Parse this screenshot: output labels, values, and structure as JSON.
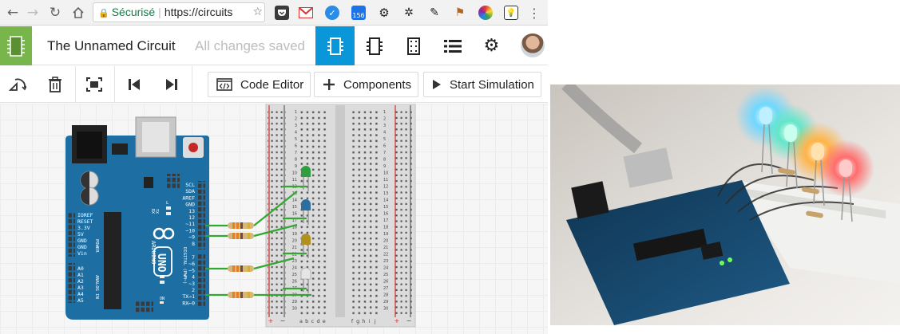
{
  "browser": {
    "secure_label": "Sécurisé",
    "url_text": "https://circuits",
    "extension_badge": "156"
  },
  "app": {
    "circuit_title": "The Unnamed Circuit",
    "save_status": "All changes saved"
  },
  "toolbar": {
    "code_editor_label": "Code Editor",
    "components_label": "Components",
    "start_simulation_label": "Start Simulation"
  },
  "arduino": {
    "brand": "ARDUINO",
    "model": "UNO",
    "digital_label": "DIGITAL (PWM~)",
    "power_label": "POWER",
    "analog_label": "ANALOG IN",
    "left_pins": [
      "IOREF",
      "RESET",
      "3.3V",
      "5V",
      "GND",
      "GND",
      "Vin"
    ],
    "analog_pins": [
      "A0",
      "A1",
      "A2",
      "A3",
      "A4",
      "A5"
    ],
    "top_right_pins": [
      "SCL",
      "SDA",
      "AREF",
      "GND",
      "13",
      "12",
      "~11",
      "~10",
      "~9",
      "8"
    ],
    "bottom_right_pins": [
      "7",
      "~6",
      "~5",
      "4",
      "~3",
      "2",
      "TX→1",
      "RX←0"
    ],
    "led_labels": [
      "TX",
      "RX"
    ],
    "l_label": "L",
    "on_label": "ON"
  },
  "breadboard": {
    "row_numbers": [
      "1",
      "2",
      "3",
      "4",
      "5",
      "6",
      "7",
      "8",
      "9",
      "10",
      "11",
      "12",
      "13",
      "14",
      "15",
      "16",
      "17",
      "18",
      "19",
      "20",
      "21",
      "22",
      "23",
      "24",
      "25",
      "26",
      "27",
      "28",
      "29",
      "30"
    ],
    "column_letters_left": [
      "a",
      "b",
      "c",
      "d",
      "e"
    ],
    "column_letters_right": [
      "f",
      "g",
      "h",
      "i",
      "j"
    ],
    "rail_plus": "+",
    "rail_minus": "−"
  },
  "colors": {
    "accent_blue": "#0a97d9",
    "tinkercad_green": "#78b54a",
    "arduino_teal": "#1d6fa3",
    "wire_green": "#32a832"
  },
  "icons": {
    "rotate": "rotate-icon",
    "delete": "trash-icon",
    "fit": "zoom-fit-icon",
    "first": "skip-back-icon",
    "last": "skip-forward-icon",
    "code": "code-icon",
    "add": "plus-icon",
    "play": "play-icon"
  }
}
